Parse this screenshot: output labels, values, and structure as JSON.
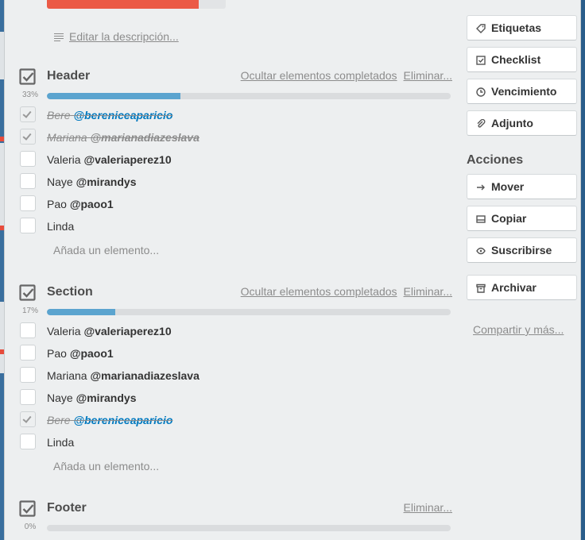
{
  "top_progress": {
    "fill_fraction": 0.85
  },
  "description": {
    "edit_label": "Editar la descripción..."
  },
  "checklists": [
    {
      "title": "Header",
      "hide_label": "Ocultar elementos completados",
      "delete_label": "Eliminar...",
      "percent": "33%",
      "progress": 0.33,
      "items": [
        {
          "name": "Bere",
          "mention": "@bereniceaparicio",
          "done": true,
          "mention_blue": true
        },
        {
          "name": "Mariana",
          "mention": "@marianadiazeslava",
          "done": true,
          "mention_blue": false
        },
        {
          "name": "Valeria",
          "mention": "@valeriaperez10",
          "done": false
        },
        {
          "name": "Naye",
          "mention": "@mirandys",
          "done": false
        },
        {
          "name": "Pao",
          "mention": "@paoo1",
          "done": false
        },
        {
          "name": "Linda",
          "mention": "",
          "done": false
        }
      ],
      "add_label": "Añada un elemento..."
    },
    {
      "title": "Section",
      "hide_label": "Ocultar elementos completados",
      "delete_label": "Eliminar...",
      "percent": "17%",
      "progress": 0.17,
      "items": [
        {
          "name": "Valeria",
          "mention": "@valeriaperez10",
          "done": false
        },
        {
          "name": "Pao",
          "mention": "@paoo1",
          "done": false
        },
        {
          "name": "Mariana",
          "mention": "@marianadiazeslava",
          "done": false
        },
        {
          "name": "Naye",
          "mention": "@mirandys",
          "done": false
        },
        {
          "name": "Bere",
          "mention": "@bereniceaparicio",
          "done": true,
          "mention_blue": true
        },
        {
          "name": "Linda",
          "mention": "",
          "done": false
        }
      ],
      "add_label": "Añada un elemento..."
    },
    {
      "title": "Footer",
      "delete_label": "Eliminar...",
      "percent": "0%",
      "progress": 0
    }
  ],
  "sidebar": {
    "add_buttons": [
      {
        "label": "Etiquetas",
        "icon": "tag-icon"
      },
      {
        "label": "Checklist",
        "icon": "checklist-icon"
      },
      {
        "label": "Vencimiento",
        "icon": "clock-icon"
      },
      {
        "label": "Adjunto",
        "icon": "paperclip-icon"
      }
    ],
    "actions_title": "Acciones",
    "action_buttons": [
      {
        "label": "Mover",
        "icon": "arrow-right-icon"
      },
      {
        "label": "Copiar",
        "icon": "copy-icon"
      },
      {
        "label": "Suscribirse",
        "icon": "eye-icon"
      },
      {
        "label": "Archivar",
        "icon": "archive-icon"
      }
    ],
    "share_label": "Compartir y más..."
  },
  "colors": {
    "progress_blue": "#5ba4cf",
    "top_red": "#eb5a46",
    "mention_blue": "#0079bf"
  }
}
